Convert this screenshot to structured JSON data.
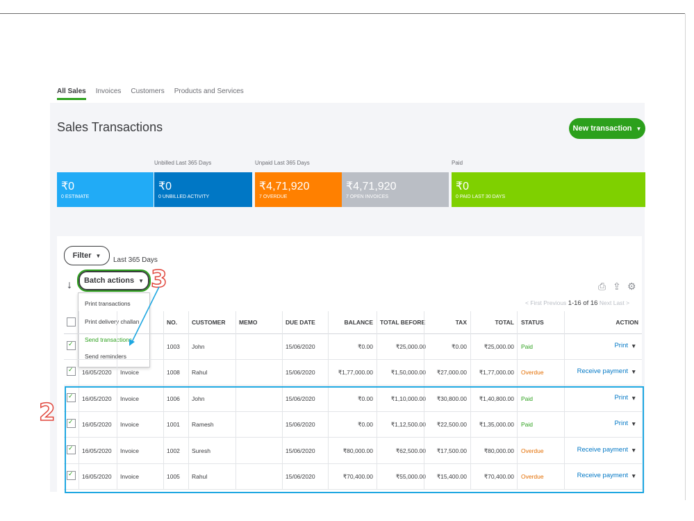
{
  "tabs": [
    "All Sales",
    "Invoices",
    "Customers",
    "Products and Services"
  ],
  "page_title": "Sales Transactions",
  "new_transaction_label": "New transaction",
  "band_labels": {
    "unbilled": "Unbilled Last 365 Days",
    "unpaid": "Unpaid Last 365 Days",
    "paid": "Paid"
  },
  "cards": [
    {
      "amount": "₹0",
      "sub": "0 ESTIMATE",
      "color": "#21abf6"
    },
    {
      "amount": "₹0",
      "sub": "0 UNBILLED ACTIVITY",
      "color": "#0077c5"
    },
    {
      "amount": "₹4,71,920",
      "sub": "7 OVERDUE",
      "color": "#ff8000"
    },
    {
      "amount": "₹4,71,920",
      "sub": "7 OPEN INVOICES",
      "color": "#babec5"
    },
    {
      "amount": "₹0",
      "sub": "0 PAID LAST 30 DAYS",
      "color": "#7fd000"
    }
  ],
  "filter_label": "Filter",
  "date_range": "Last 365 Days",
  "batch_label": "Batch actions",
  "batch_menu": [
    "Print transactions",
    "Print delivery challan",
    "Send transactions",
    "Send reminders"
  ],
  "pager": {
    "first": "< First",
    "previous": "Previous",
    "range": "1-16 of 16",
    "next": "Next",
    "last": "Last >"
  },
  "columns": [
    "NO.",
    "CUSTOMER",
    "MEMO",
    "DUE DATE",
    "BALANCE",
    "TOTAL BEFORE TA",
    "TAX",
    "TOTAL",
    "STATUS",
    "ACTION"
  ],
  "rows": [
    {
      "date": "",
      "type": "",
      "no": "1003",
      "customer": "John",
      "memo": "",
      "due": "15/06/2020",
      "balance": "₹0.00",
      "before_tax": "₹25,000.00",
      "tax": "₹0.00",
      "total": "₹25,000.00",
      "status": "Paid",
      "action": "Print"
    },
    {
      "date": "16/05/2020",
      "type": "Invoice",
      "no": "1008",
      "customer": "Rahul",
      "memo": "",
      "due": "15/06/2020",
      "balance": "₹1,77,000.00",
      "before_tax": "₹1,50,000.00",
      "tax": "₹27,000.00",
      "total": "₹1,77,000.00",
      "status": "Overdue",
      "action": "Receive payment"
    },
    {
      "date": "16/05/2020",
      "type": "Invoice",
      "no": "1006",
      "customer": "John",
      "memo": "",
      "due": "15/06/2020",
      "balance": "₹0.00",
      "before_tax": "₹1,10,000.00",
      "tax": "₹30,800.00",
      "total": "₹1,40,800.00",
      "status": "Paid",
      "action": "Print"
    },
    {
      "date": "16/05/2020",
      "type": "Invoice",
      "no": "1001",
      "customer": "Ramesh",
      "memo": "",
      "due": "15/06/2020",
      "balance": "₹0.00",
      "before_tax": "₹1,12,500.00",
      "tax": "₹22,500.00",
      "total": "₹1,35,000.00",
      "status": "Paid",
      "action": "Print"
    },
    {
      "date": "16/05/2020",
      "type": "Invoice",
      "no": "1002",
      "customer": "Suresh",
      "memo": "",
      "due": "15/06/2020",
      "balance": "₹80,000.00",
      "before_tax": "₹62,500.00",
      "tax": "₹17,500.00",
      "total": "₹80,000.00",
      "status": "Overdue",
      "action": "Receive payment"
    },
    {
      "date": "16/05/2020",
      "type": "Invoice",
      "no": "1005",
      "customer": "Rahul",
      "memo": "",
      "due": "15/06/2020",
      "balance": "₹70,400.00",
      "before_tax": "₹55,000.00",
      "tax": "₹15,400.00",
      "total": "₹70,400.00",
      "status": "Overdue",
      "action": "Receive payment"
    }
  ],
  "annotations": {
    "step_2": "2",
    "step_3": "3"
  },
  "icons": [
    "sort-icon",
    "print-icon",
    "export-icon",
    "settings-icon",
    "caret-down-icon",
    "checkbox-icon",
    "arrow-icon"
  ]
}
